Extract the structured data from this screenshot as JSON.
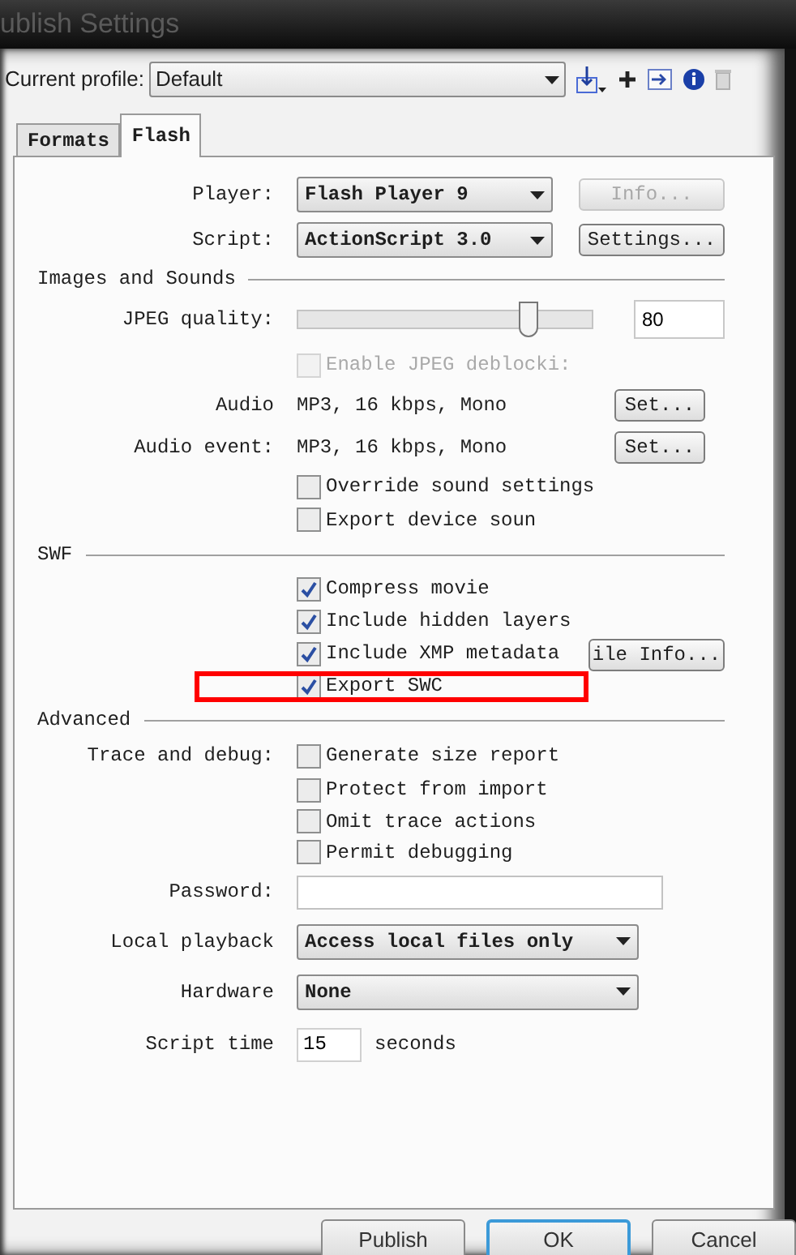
{
  "window": {
    "title": "ublish Settings"
  },
  "profile": {
    "label": "Current profile:",
    "value": "Default"
  },
  "tabs": [
    {
      "label": "Formats",
      "selected": false
    },
    {
      "label": "Flash",
      "selected": true
    }
  ],
  "player": {
    "label": "Player:",
    "value": "Flash Player 9",
    "button": {
      "label": "Info...",
      "disabled": true
    }
  },
  "script": {
    "label": "Script:",
    "value": "ActionScript 3.0",
    "button": {
      "label": "Settings...",
      "disabled": false
    }
  },
  "images_and_sounds": {
    "title": "Images and Sounds",
    "jpeg_quality": {
      "label": "JPEG quality:",
      "level": 0.78,
      "value": "80"
    },
    "deblocking": {
      "label": "Enable JPEG deblocki:",
      "checked": false,
      "disabled": true
    },
    "audio": [
      {
        "label": "Audio",
        "value": "MP3, 16 kbps, Mono",
        "button": "Set..."
      },
      {
        "label": "Audio event:",
        "value": "MP3, 16 kbps, Mono",
        "button": "Set..."
      }
    ],
    "options": [
      {
        "label": "Override sound settings",
        "checked": false
      },
      {
        "label": "Export device soun",
        "checked": false
      }
    ]
  },
  "swf": {
    "title": "SWF",
    "file_info_button": "ile Info...",
    "options": [
      {
        "label": "Compress movie",
        "checked": true
      },
      {
        "label": "Include hidden layers",
        "checked": true
      },
      {
        "label": "Include XMP metadata",
        "checked": true
      },
      {
        "label": "Export SWC",
        "checked": true
      }
    ]
  },
  "advanced": {
    "title": "Advanced",
    "trace_label": "Trace and debug:",
    "options": [
      {
        "label": "Generate size report",
        "checked": false
      },
      {
        "label": "Protect from import",
        "checked": false
      },
      {
        "label": "Omit trace actions",
        "checked": false
      },
      {
        "label": "Permit debugging",
        "checked": false
      }
    ],
    "password": {
      "label": "Password:"
    },
    "local_playback": {
      "label": "Local playback",
      "value": "Access local files only"
    },
    "hardware": {
      "label": "Hardware",
      "value": "None"
    },
    "script_time": {
      "label": "Script time",
      "value": "15",
      "unit": "seconds"
    }
  },
  "buttons": [
    {
      "label": "Publish",
      "selected": false
    },
    {
      "label": "OK",
      "selected": true
    },
    {
      "label": "Cancel",
      "selected": false
    }
  ]
}
